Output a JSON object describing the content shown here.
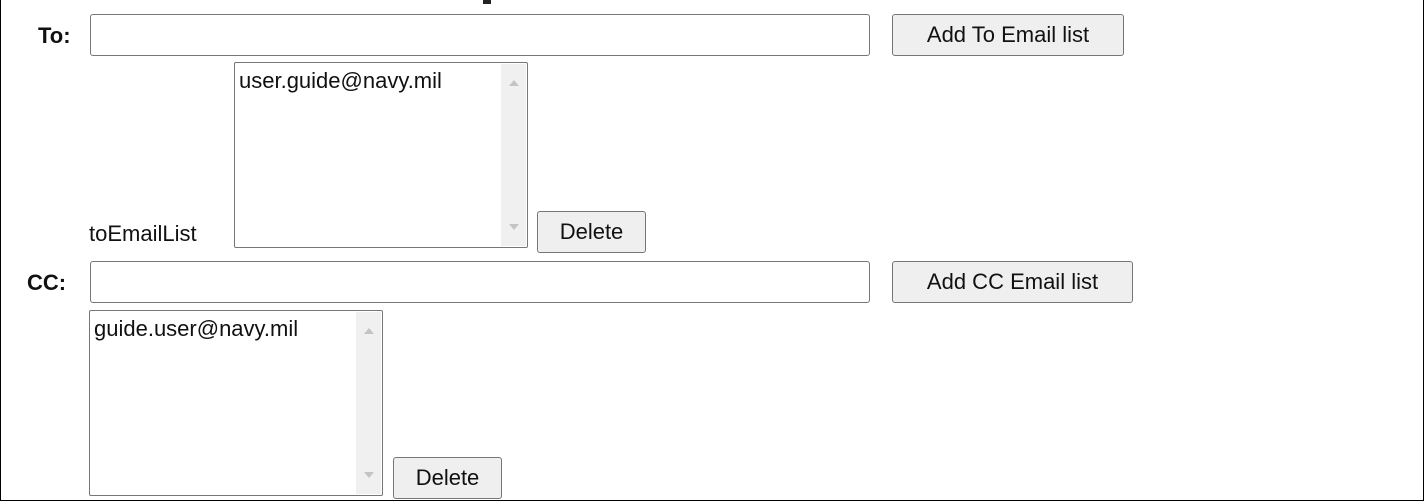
{
  "to": {
    "label": "To:",
    "value": "",
    "add_button_label": "Add To Email list",
    "list_label": "toEmailList",
    "list_items": [
      "user.guide@navy.mil"
    ],
    "delete_button_label": "Delete"
  },
  "cc": {
    "label": "CC:",
    "value": "",
    "add_button_label": "Add CC Email list",
    "list_items": [
      "guide.user@navy.mil"
    ],
    "delete_button_label": "Delete"
  }
}
